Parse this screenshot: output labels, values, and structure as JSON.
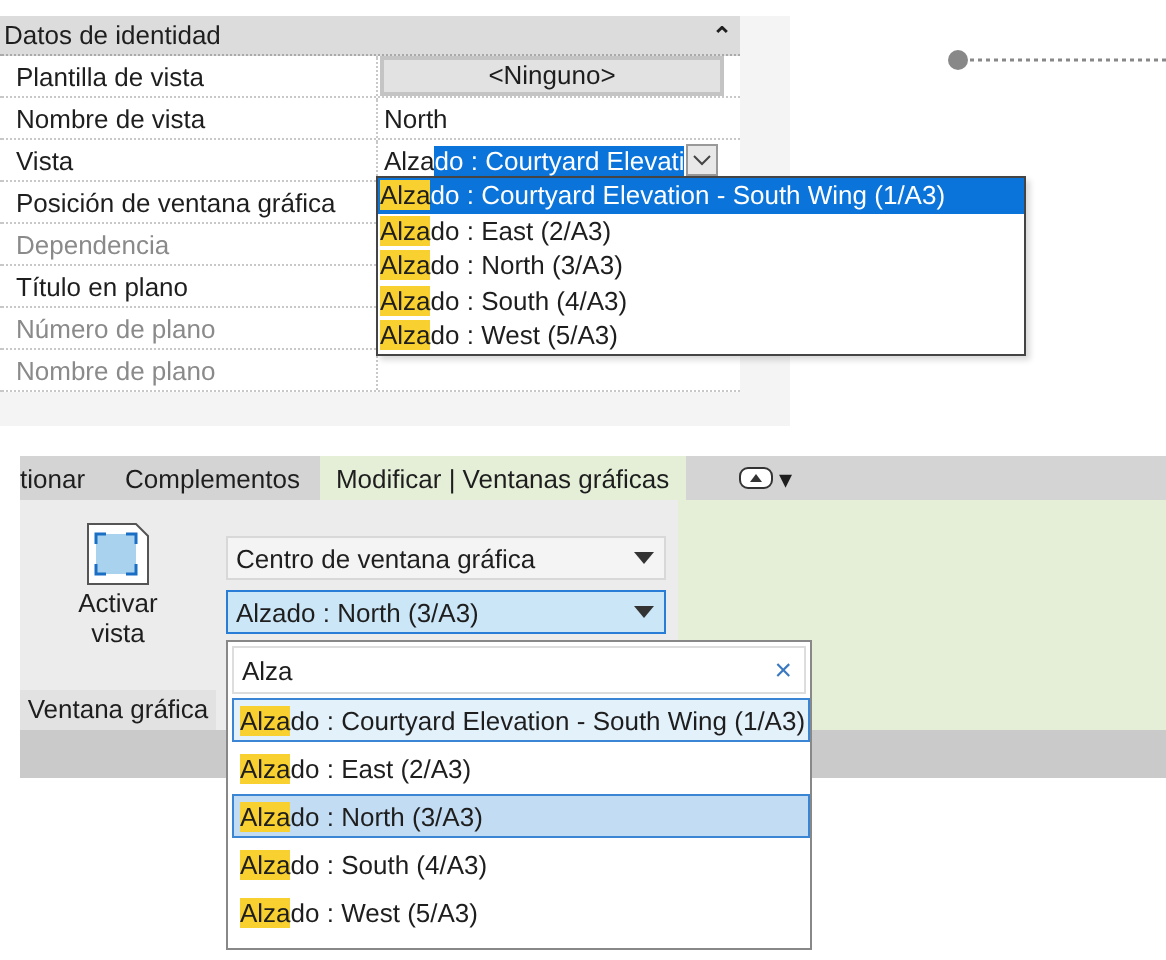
{
  "properties": {
    "section": "Datos de identidad",
    "collapse_icon": "⌃",
    "rows": [
      {
        "label": "Plantilla de vista",
        "kind": "button",
        "value": "<Ninguno>",
        "disabled": false
      },
      {
        "label": "Nombre de vista",
        "kind": "text",
        "value": "North",
        "disabled": false
      },
      {
        "label": "Vista",
        "kind": "combo",
        "value_match": "Alza",
        "value_selected": "do : Courtyard Elevati",
        "disabled": false
      },
      {
        "label": "Posición de ventana gráfica",
        "kind": "empty",
        "disabled": false
      },
      {
        "label": "Dependencia",
        "kind": "empty",
        "disabled": true
      },
      {
        "label": "Título en plano",
        "kind": "empty",
        "disabled": false
      },
      {
        "label": "Número de plano",
        "kind": "empty",
        "disabled": true
      },
      {
        "label": "Nombre de plano",
        "kind": "empty",
        "disabled": true
      }
    ],
    "dropdown": [
      {
        "match": "Alza",
        "rest": "do : Courtyard Elevation - South Wing (1/A3)",
        "selected": true
      },
      {
        "match": "Alza",
        "rest": "do : East (2/A3)",
        "selected": false
      },
      {
        "match": "Alza",
        "rest": "do : North (3/A3)",
        "selected": false
      },
      {
        "match": "Alza",
        "rest": "do : South (4/A3)",
        "selected": false
      },
      {
        "match": "Alza",
        "rest": "do : West (5/A3)",
        "selected": false
      }
    ]
  },
  "ribbon": {
    "tabs": [
      {
        "label": "tionar",
        "selected": false
      },
      {
        "label": "Complementos",
        "selected": false
      },
      {
        "label": "Modificar | Ventanas gráficas",
        "selected": true
      }
    ],
    "tab_menu_caret": "▾",
    "activate_button": "Activar vista",
    "group_label": "Ventana gráfica",
    "position_combo": "Centro de ventana gráfica",
    "view_combo": "Alzado : North (3/A3)",
    "search": {
      "value": "Alza",
      "clear": "×"
    },
    "results": [
      {
        "match": "Alza",
        "rest": "do : Courtyard Elevation - South Wing (1/A3)",
        "selected": false,
        "hovered": true
      },
      {
        "match": "Alza",
        "rest": "do : East (2/A3)",
        "selected": false,
        "hovered": false
      },
      {
        "match": "Alza",
        "rest": "do : North (3/A3)",
        "selected": true,
        "hovered": false
      },
      {
        "match": "Alza",
        "rest": "do : South (4/A3)",
        "selected": false,
        "hovered": false
      },
      {
        "match": "Alza",
        "rest": "do : West (5/A3)",
        "selected": false,
        "hovered": false
      }
    ]
  }
}
